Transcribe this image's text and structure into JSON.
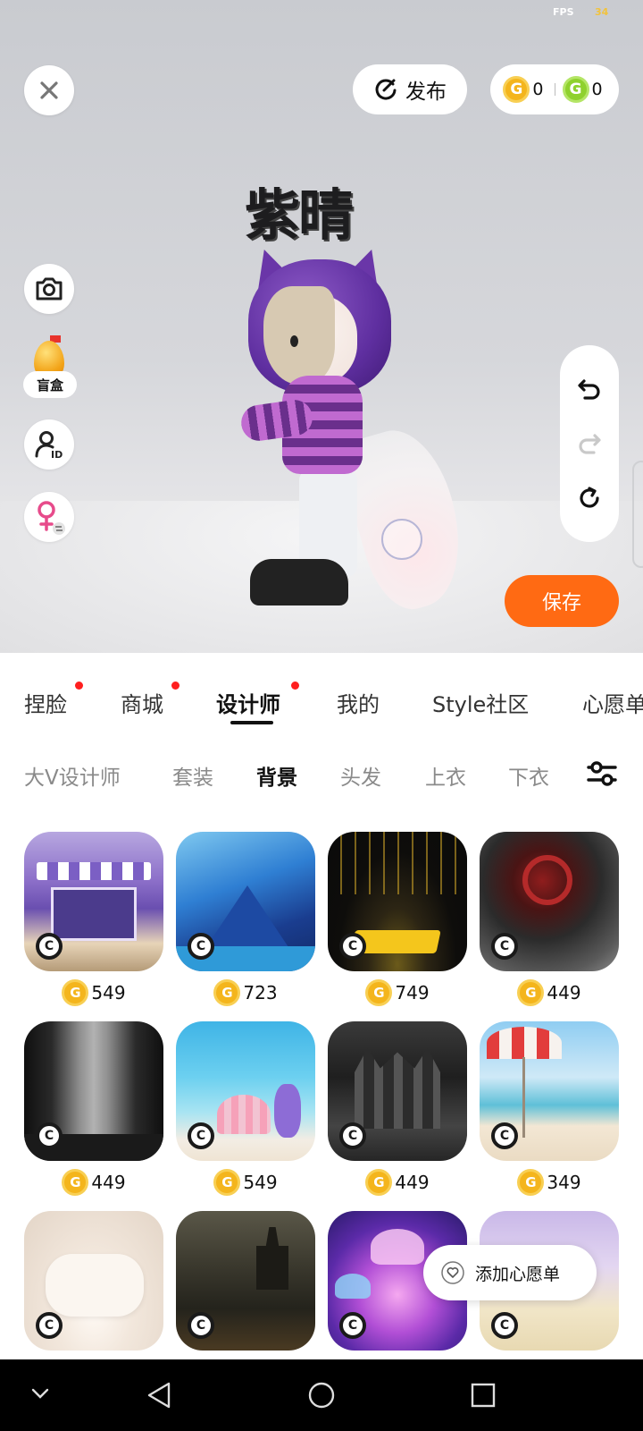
{
  "status": {
    "fps_label": "FPS",
    "fps_value": "34"
  },
  "top": {
    "publish_label": "发布",
    "gold_coins": "0",
    "green_coins": "0"
  },
  "side": {
    "blindbox_label": "盲盒"
  },
  "save_label": "保存",
  "tabs": [
    {
      "label": "捏脸",
      "dot": true
    },
    {
      "label": "商城",
      "dot": true
    },
    {
      "label": "设计师",
      "dot": true,
      "active": true
    },
    {
      "label": "我的",
      "dot": false
    },
    {
      "label": "Style社区",
      "dot": false
    },
    {
      "label": "心愿单",
      "dot": false
    }
  ],
  "subtabs": [
    "大V设计师",
    "套装",
    "背景",
    "头发",
    "上衣",
    "下衣"
  ],
  "subtab_active": "背景",
  "items": [
    {
      "price": "549",
      "theme": "cafe"
    },
    {
      "price": "723",
      "theme": "blue-mountains"
    },
    {
      "price": "749",
      "theme": "gold-stage"
    },
    {
      "price": "449",
      "theme": "red-eye-smoke"
    },
    {
      "price": "449",
      "theme": "misty-portal"
    },
    {
      "price": "549",
      "theme": "underwater-shell"
    },
    {
      "price": "449",
      "theme": "dark-castle"
    },
    {
      "price": "349",
      "theme": "beach-umbrella"
    },
    {
      "theme": "fluffy-couch"
    },
    {
      "theme": "night-castle"
    },
    {
      "theme": "jellyfish"
    },
    {
      "theme": "pastel-sky"
    }
  ],
  "wishlist_label": "添加心愿单",
  "avatar_name": "紫晴",
  "colors": {
    "accent": "#ff6a13",
    "dot": "#ff1f1f",
    "gold": "#f4b51c",
    "green": "#8fd12e"
  }
}
